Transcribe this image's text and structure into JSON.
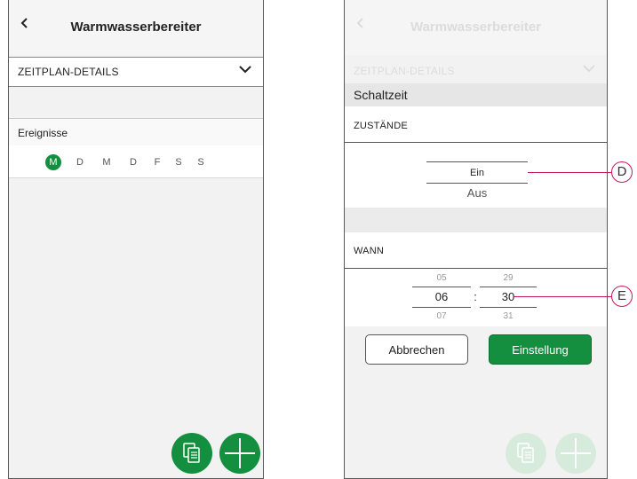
{
  "left": {
    "title": "Warmwasserbereiter",
    "back_icon": "chevron-left-icon",
    "schedule_details": "ZEITPLAN-DETAILS",
    "events_label": "Ereignisse",
    "days": [
      "M",
      "D",
      "M",
      "D",
      "F",
      "S",
      "S"
    ],
    "active_day_index": 0
  },
  "right": {
    "title": "Warmwasserbereiter",
    "schedule_details": "ZEITPLAN-DETAILS",
    "switch_time": "Schaltzeit",
    "states_label": "ZUSTÄNDE",
    "state_options": {
      "selected": "Ein",
      "next": "Aus"
    },
    "when_label": "WANN",
    "time_picker": {
      "hour_prev": "05",
      "hour": "06",
      "hour_next": "07",
      "separator": ":",
      "minute_prev": "29",
      "minute": "30",
      "minute_next": "31"
    },
    "cancel_label": "Abbrechen",
    "set_label": "Einstellung"
  },
  "callouts": {
    "d": "D",
    "e": "E"
  },
  "colors": {
    "accent": "#138f3f",
    "callout": "#c2185b"
  }
}
